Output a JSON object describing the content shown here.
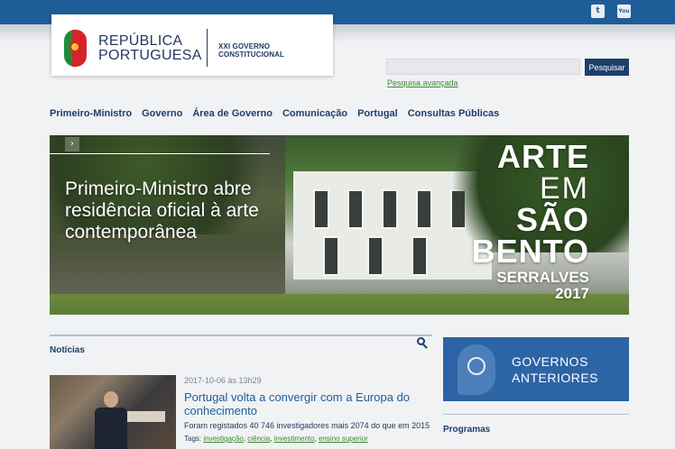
{
  "header": {
    "brand_line1": "REPÚBLICA",
    "brand_line2": "PORTUGUESA",
    "government": "XXI GOVERNO CONSTITUCIONAL",
    "social": {
      "twitter_glyph": "t",
      "youtube_glyph": "You"
    }
  },
  "search": {
    "placeholder": "",
    "button_label": "Pesquisar",
    "advanced_label": "Pesquisa avançada"
  },
  "nav": {
    "items": [
      "Primeiro-Ministro",
      "Governo",
      "Área de Governo",
      "Comunicação",
      "Portugal",
      "Consultas Públicas"
    ]
  },
  "hero": {
    "arrow": "›",
    "headline": "Primeiro-Ministro abre residência oficial à arte contemporânea",
    "art_lines": [
      "ARTE",
      "EM",
      "SÃO",
      "BENTO",
      "SERRALVES",
      "2017"
    ]
  },
  "news": {
    "section_title": "Notícias",
    "date": "2017-10-06 às 13h29",
    "headline": "Portugal volta a convergir com a Europa do conhecimento",
    "excerpt": "Foram registados 40 746 investigadores mais 2074 do que em 2015",
    "tags_label": "Tags:",
    "tags": [
      "investigação",
      "ciência",
      "investimento",
      "ensino superior"
    ]
  },
  "sidebar": {
    "previous_governments": "GOVERNOS ANTERIORES",
    "programs_title": "Programas"
  },
  "colors": {
    "topbar": "#1f5d98",
    "navy": "#1d3f6b",
    "link_green": "#3a8a2e",
    "card_blue": "#2d64a6"
  }
}
